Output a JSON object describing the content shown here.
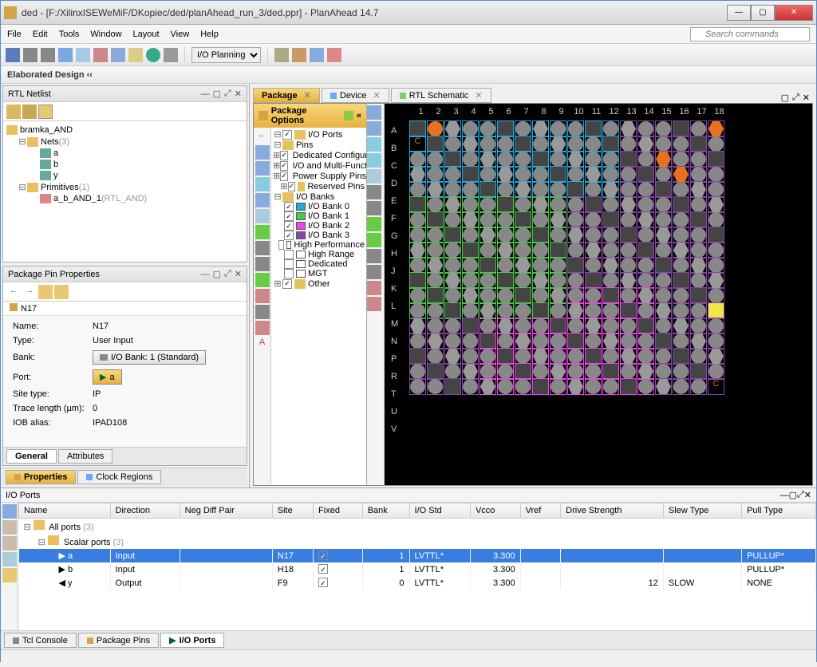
{
  "window": {
    "title": "ded - [F:/XilinxISEWeMiF/DKopiec/ded/planAhead_run_3/ded.ppr] - PlanAhead 14.7",
    "min": "—",
    "max": "▢",
    "close": "✕"
  },
  "menu": {
    "file": "File",
    "edit": "Edit",
    "tools": "Tools",
    "window": "Window",
    "layout": "Layout",
    "view": "View",
    "help": "Help"
  },
  "search_placeholder": "Search commands",
  "toolbar_select": "I/O Planning",
  "subbar": "Elaborated Design  ‹‹",
  "rtl": {
    "title": "RTL Netlist",
    "root": "bramka_AND",
    "nets_label": "Nets",
    "nets_count": "(3)",
    "net_items": [
      "a",
      "b",
      "y"
    ],
    "prims_label": "Primitives",
    "prims_count": "(1)",
    "prim_name": "a_b_AND_1",
    "prim_type": "(RTL_AND)"
  },
  "props": {
    "title": "Package Pin Properties",
    "back_sym": "←",
    "fwd_sym": "→",
    "breadcrumb": "N17",
    "rows": {
      "name_l": "Name:",
      "name_v": "N17",
      "type_l": "Type:",
      "type_v": "User Input",
      "bank_l": "Bank:",
      "bank_v": "I/O Bank: 1 (Standard)",
      "port_l": "Port:",
      "port_v": "a",
      "site_l": "Site type:",
      "site_v": "IP",
      "trace_l": "Trace length (µm):",
      "trace_v": "0",
      "iob_l": "IOB alias:",
      "iob_v": "IPAD108"
    },
    "tab_general": "General",
    "tab_attrs": "Attributes",
    "bot_props": "Properties",
    "bot_clock": "Clock Regions"
  },
  "editor": {
    "t_package": "Package",
    "t_device": "Device",
    "t_rtl": "RTL Schematic",
    "pkg_opts": "Package Options",
    "tree": {
      "ioports": "I/O Ports",
      "pins": "Pins",
      "dedconf": "Dedicated Configur",
      "iomulti": "I/O and Multi-Funct",
      "power": "Power Supply Pins",
      "reserved": "Reserved Pins",
      "iobanks": "I/O Banks",
      "bank0": "I/O Bank 0",
      "bank1": "I/O Bank 1",
      "bank2": "I/O Bank 2",
      "bank3": "I/O Bank 3",
      "hiperf": "High Performance",
      "hirange": "High Range",
      "dedicated": "Dedicated",
      "mgt": "MGT",
      "other": "Other"
    },
    "cols": [
      "1",
      "2",
      "3",
      "4",
      "5",
      "6",
      "7",
      "8",
      "9",
      "10",
      "11",
      "12",
      "13",
      "14",
      "15",
      "16",
      "17",
      "18"
    ],
    "rows": [
      "A",
      "B",
      "C",
      "D",
      "E",
      "F",
      "G",
      "H",
      "J",
      "K",
      "L",
      "M",
      "N",
      "P",
      "R",
      "T",
      "U",
      "V"
    ]
  },
  "io": {
    "title": "I/O Ports",
    "headers": [
      "Name",
      "Direction",
      "Neg Diff Pair",
      "Site",
      "Fixed",
      "Bank",
      "I/O Std",
      "Vcco",
      "Vref",
      "Drive Strength",
      "Slew Type",
      "Pull Type"
    ],
    "all_label": "All ports",
    "all_count": "(3)",
    "scalar_label": "Scalar ports",
    "scalar_count": "(3)",
    "rows": [
      {
        "name": "a",
        "dir": "Input",
        "site": "N17",
        "fixed": "✓",
        "bank": "1",
        "std": "LVTTL*",
        "vcco": "3.300",
        "drive": "",
        "slew": "",
        "pull": "PULLUP*"
      },
      {
        "name": "b",
        "dir": "Input",
        "site": "H18",
        "fixed": "✓",
        "bank": "1",
        "std": "LVTTL*",
        "vcco": "3.300",
        "drive": "",
        "slew": "",
        "pull": "PULLUP*"
      },
      {
        "name": "y",
        "dir": "Output",
        "site": "F9",
        "fixed": "✓",
        "bank": "0",
        "std": "LVTTL*",
        "vcco": "3.300",
        "drive": "12",
        "slew": "SLOW",
        "pull": "NONE"
      }
    ],
    "bot_tcl": "Tcl Console",
    "bot_pins": "Package Pins",
    "bot_io": "I/O Ports"
  }
}
